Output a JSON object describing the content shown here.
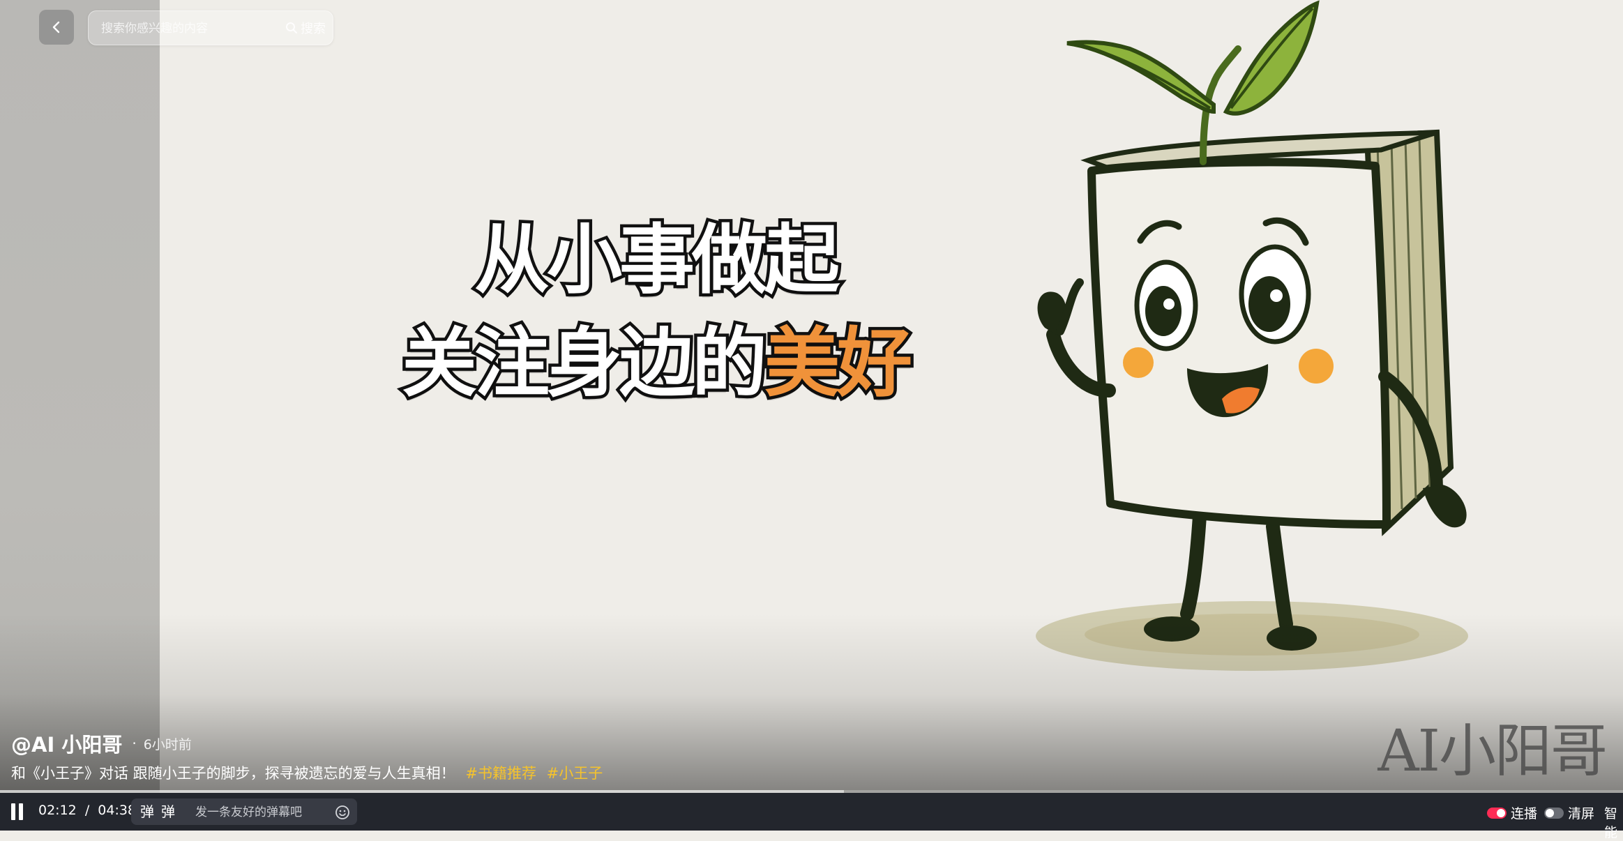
{
  "search": {
    "placeholder": "搜索你感兴趣的内容",
    "button_label": "搜索"
  },
  "video": {
    "headline_line1": "从小事做起",
    "headline_line2_main": "关注身边的",
    "headline_line2_accent": "美好",
    "watermark": "AI小阳哥",
    "progress": 0.52
  },
  "post": {
    "author": "@AI 小阳哥",
    "separator": "·",
    "time_ago": "6小时前",
    "description": "和《小王子》对话 跟随小王子的脚步，探寻被遗忘的爱与人生真相！",
    "tags": [
      "#书籍推荐",
      "#小王子"
    ]
  },
  "controls": {
    "current_time": "02:12",
    "divider": "/",
    "duration": "04:38",
    "danmu_icon_1": "弹",
    "danmu_icon_2": "弹",
    "danmu_placeholder": "发一条友好的弹幕吧",
    "autoplay_label": "连播",
    "autoplay_on": true,
    "clear_screen_label": "清屏",
    "clear_screen_on": false,
    "smart_label": "智能"
  },
  "colors": {
    "accent_orange": "#f0923a",
    "tag_yellow": "#f5c32c",
    "toggle_on": "#fe2c55",
    "control_bar": "#23262d"
  },
  "icons": [
    "back-icon",
    "search-icon",
    "pause-icon",
    "danmu-icon",
    "emoji-icon"
  ]
}
